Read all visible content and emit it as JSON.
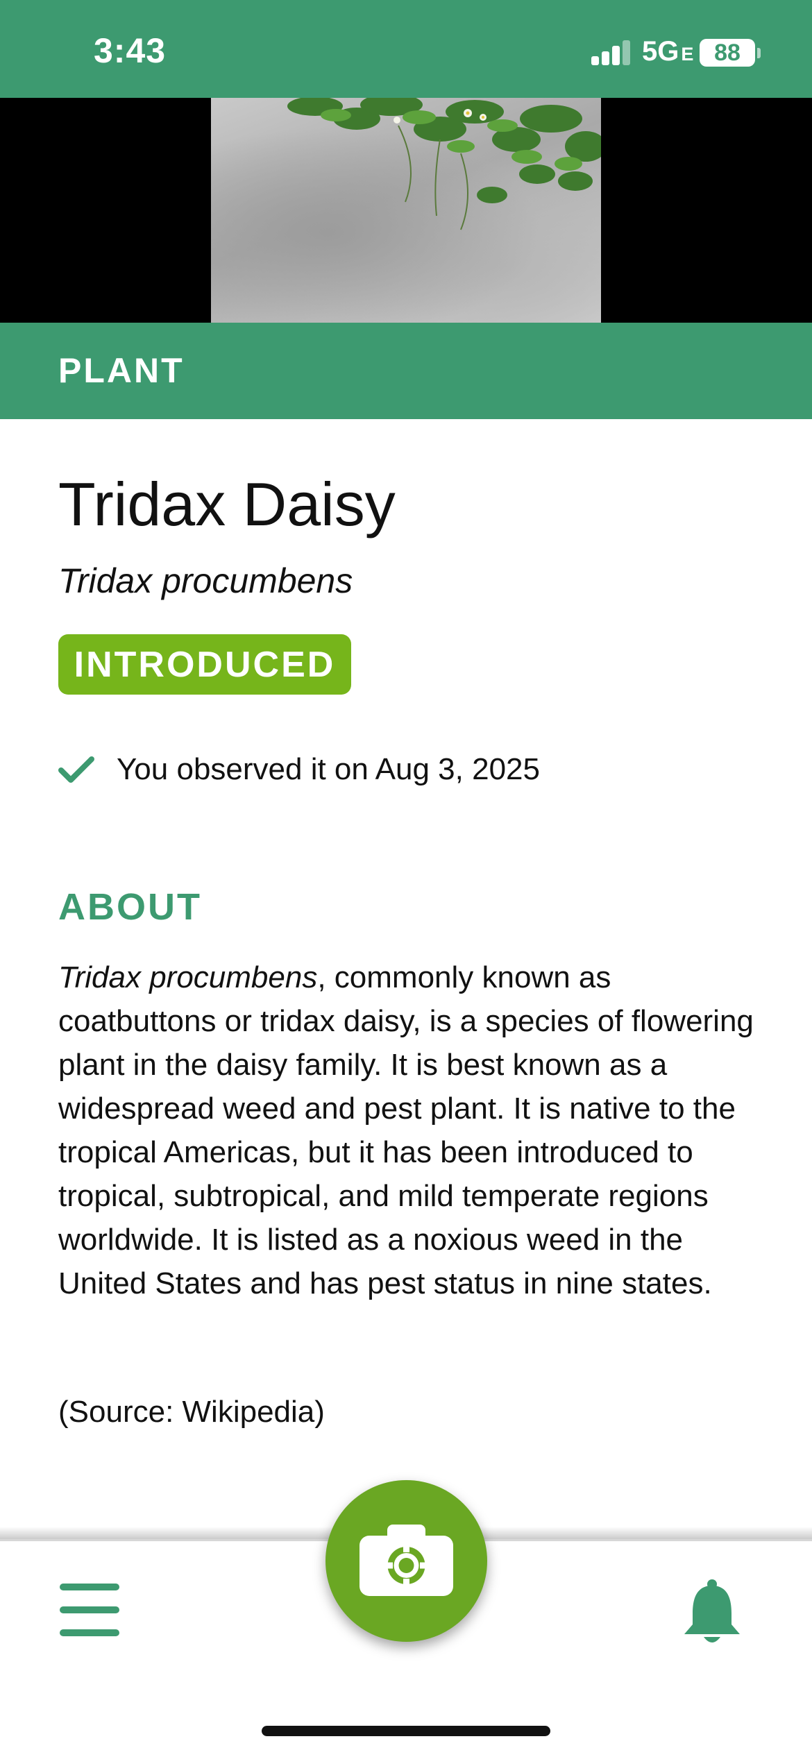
{
  "status_bar": {
    "time": "3:43",
    "network": "5G",
    "network_suffix": "E",
    "battery": "88"
  },
  "category": "PLANT",
  "species": {
    "common_name": "Tridax Daisy",
    "scientific_name": "Tridax procumbens",
    "status": "INTRODUCED"
  },
  "observation": {
    "text": "You observed it on Aug 3, 2025"
  },
  "about": {
    "heading": "ABOUT",
    "lead_italic": "Tridax procumbens",
    "body": ", commonly known as coatbuttons or tridax daisy, is a species of flowering plant in the daisy family. It is best known as a widespread weed and pest plant. It is native to the tropical Americas, but it has been introduced to tropical, subtropical, and mild temperate regions worldwide. It is listed as a noxious weed in the United States and has pest status in nine states.",
    "source": "(Source: Wikipedia)"
  },
  "nav": {
    "left_icon": "menu-icon",
    "center_icon": "camera-icon",
    "right_icon": "bell-icon"
  },
  "colors": {
    "primary_green": "#3d9a70",
    "badge_green": "#76b51b",
    "camera_green": "#6aa723"
  }
}
